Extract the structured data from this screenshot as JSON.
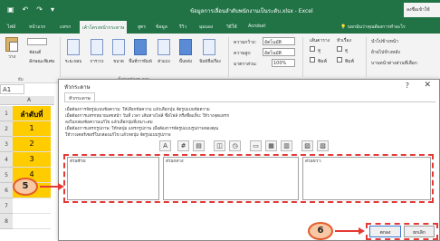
{
  "window": {
    "title": "ข้อมูลการเลื่อนลำดับพนักงานเป็นระดับ.xlsx - Excel",
    "account": "ลงชื่อเข้าใช้"
  },
  "tabs": [
    {
      "label": "ไฟล์"
    },
    {
      "label": "หน้าแรก"
    },
    {
      "label": "แทรก"
    },
    {
      "label": "เค้าโครงหน้ากระดาษ"
    },
    {
      "label": "สูตร"
    },
    {
      "label": "ข้อมูล"
    },
    {
      "label": "รีวิว"
    },
    {
      "label": "มุมมอง"
    },
    {
      "label": "วิธีใช้"
    },
    {
      "label": "Acrobat"
    }
  ],
  "tellme": "บอกฉันว่าคุณต้องการทำอะไร",
  "ribbon": {
    "paste": "วาง",
    "font_label": "ฟอนต์",
    "effects_label": "ลักษณะพิเศษ",
    "margins": "ระยะขอบ",
    "orientation": "การวาง",
    "size": "ขนาด",
    "print_area": "พื้นที่การพิมพ์",
    "breaks": "ตัวแบ่ง",
    "background": "พื้นหลัง",
    "print_titles": "พิมพ์ชื่อเรื่อง",
    "width_label": "ความกว้าง:",
    "width_value": "อัตโนมัติ",
    "height_label": "ความสูง:",
    "height_value": "อัตโนมัติ",
    "scale_label": "มาตราส่วน:",
    "scale_value": "100%",
    "gridlines_label": "เส้นตาราง",
    "headings_label": "หัวเรื่อง",
    "view_label": "ดู",
    "print_label": "พิมพ์",
    "bring_forward": "นำไปข้างหน้า",
    "send_backward": "ย้ายไปข้างหลัง",
    "selection_pane": "บานหน้าต่างส่วนที่เลือก",
    "group_theme": "ธีม",
    "group_pagesetup": "ตั้งค่าหน้ากระดาษ"
  },
  "namebox": "A1",
  "sheet": {
    "col_a": "A",
    "rows": [
      {
        "num": "1",
        "value": "ลำดับที่"
      },
      {
        "num": "2",
        "value": "1"
      },
      {
        "num": "3",
        "value": "2"
      },
      {
        "num": "4",
        "value": "3"
      },
      {
        "num": "5",
        "value": "4"
      },
      {
        "num": "6",
        "value": "5"
      },
      {
        "num": "7",
        "value": ""
      },
      {
        "num": "8",
        "value": ""
      }
    ]
  },
  "dialog": {
    "title": "หัวกระดาษ",
    "tab": "หัวกระดาษ",
    "instructions": [
      "เมื่อต้องการจัดรูปแบบข้อความ: ให้เลือกข้อความ แล้วเลือกปุ่ม จัดรูปแบบข้อความ",
      "เมื่อต้องการแทรกหมายเลขหน้า วันที่ เวลา เส้นทางไฟล์ ชื่อไฟล์ หรือชื่อแท็บ: ให้วางจุดแทรก",
      "    ลงในกล่องข้อความแก้ไข แล้วเลือกปุ่มที่เหมาะสม",
      "เมื่อต้องการแทรกรูปภาพ: ให้กดปุ่ม แทรกรูปภาพ เมื่อต้องการจัดรูปแบบรูปภาพของคุณ",
      "    ให้วางเคอร์เซอร์ในกล่องแก้ไข แล้วกดปุ่ม จัดรูปแบบรูปภาพ"
    ],
    "toolbar": [
      "A",
      "#",
      "▤",
      "◫",
      "◷",
      "▭",
      "▦",
      "▥",
      "▨",
      "▧"
    ],
    "section_left": "ส่วนซ้าย:",
    "section_center": "ส่วนกลาง:",
    "section_right": "ส่วนขวา:",
    "ok": "ตกลง",
    "cancel": "ยกเลิก"
  },
  "callouts": {
    "c5": "5",
    "c6": "6"
  },
  "colors": {
    "excel_green": "#217346",
    "highlight_cell": "#ffcc00",
    "callout_fill": "#f7c8a3",
    "annotation_red": "#e53935"
  }
}
